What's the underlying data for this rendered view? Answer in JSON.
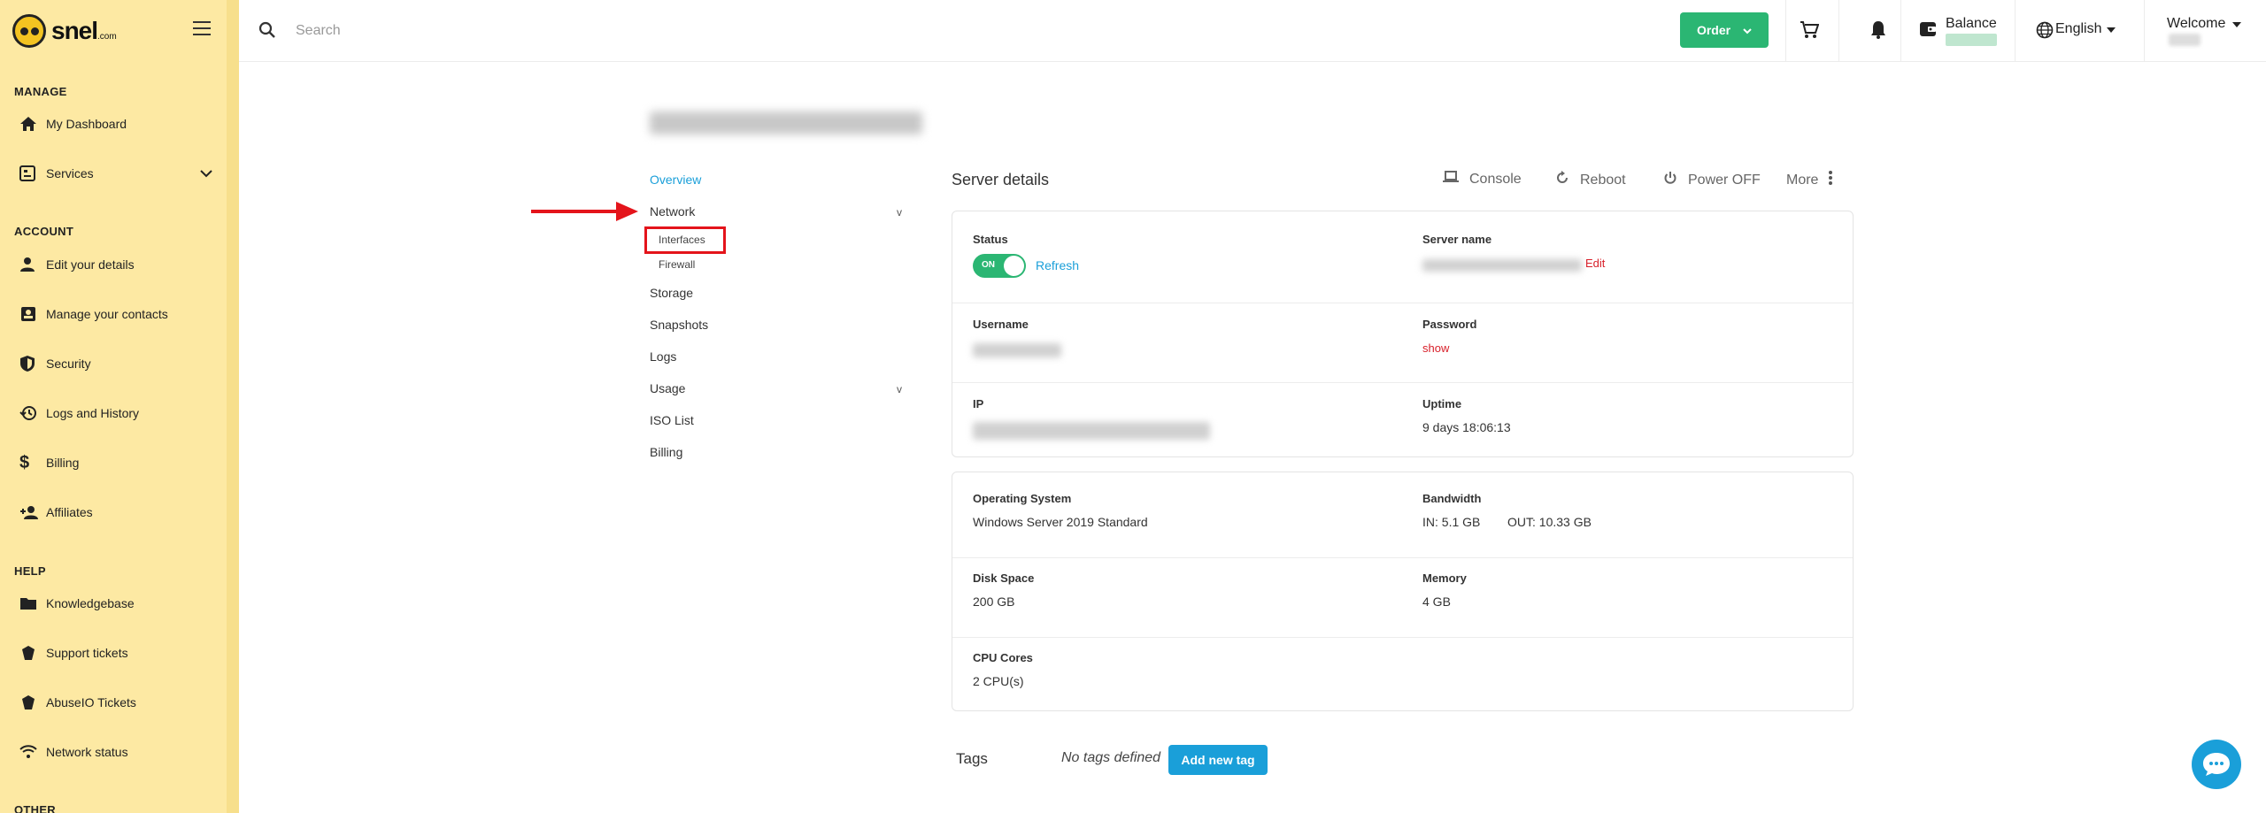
{
  "sidebar": {
    "logo_text": "snel",
    "logo_suffix": ".com",
    "sections": {
      "manage": "MANAGE",
      "account": "ACCOUNT",
      "help": "HELP",
      "other": "OTHER"
    },
    "items": {
      "dashboard": "My Dashboard",
      "services": "Services",
      "edit_details": "Edit your details",
      "contacts": "Manage your contacts",
      "security": "Security",
      "logs": "Logs and History",
      "billing": "Billing",
      "affiliates": "Affiliates",
      "knowledgebase": "Knowledgebase",
      "support": "Support tickets",
      "abuse": "AbuseIO Tickets",
      "network_status": "Network status"
    }
  },
  "topbar": {
    "search_placeholder": "Search",
    "order_label": "Order",
    "balance_label": "Balance",
    "language": "English",
    "welcome": "Welcome"
  },
  "server_nav": {
    "overview": "Overview",
    "network": "Network",
    "interfaces": "Interfaces",
    "firewall": "Firewall",
    "storage": "Storage",
    "snapshots": "Snapshots",
    "logs": "Logs",
    "usage": "Usage",
    "iso_list": "ISO List",
    "billing": "Billing",
    "chevron": "v"
  },
  "details": {
    "title": "Server details",
    "console": "Console",
    "reboot": "Reboot",
    "power_off": "Power OFF",
    "more": "More",
    "status_label": "Status",
    "status_toggle": "ON",
    "refresh": "Refresh",
    "server_name_label": "Server name",
    "edit": "Edit",
    "username_label": "Username",
    "password_label": "Password",
    "show": "show",
    "ip_label": "IP",
    "uptime_label": "Uptime",
    "uptime_value": "9 days 18:06:13",
    "os_label": "Operating System",
    "os_value": "Windows Server 2019 Standard",
    "bandwidth_label": "Bandwidth",
    "bandwidth_in": "IN: 5.1 GB",
    "bandwidth_out": "OUT: 10.33 GB",
    "disk_label": "Disk Space",
    "disk_value": "200 GB",
    "memory_label": "Memory",
    "memory_value": "4 GB",
    "cpu_label": "CPU Cores",
    "cpu_value": "2 CPU(s)"
  },
  "tags": {
    "label": "Tags",
    "empty": "No tags defined",
    "add_button": "Add new tag"
  },
  "colors": {
    "sidebar_bg": "#fde9a3",
    "accent_green": "#2bb673",
    "accent_blue": "#1a9fd9",
    "highlight_red": "#e4141b"
  }
}
